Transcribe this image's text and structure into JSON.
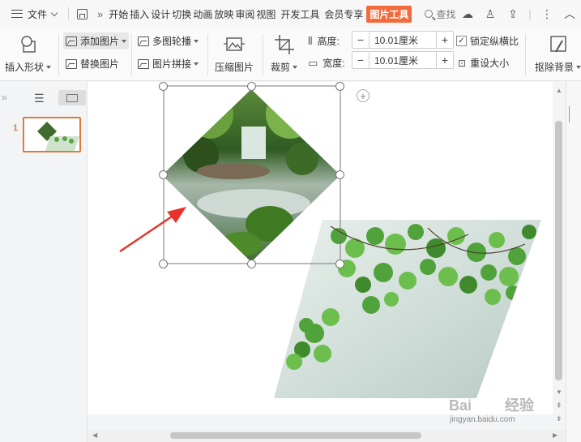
{
  "menu": {
    "file_label": "文件",
    "tabs": [
      "开始",
      "插入",
      "设计",
      "切换",
      "动画",
      "放映",
      "审阅",
      "视图",
      "开发工具",
      "会员专享"
    ],
    "active_tab": "图片工具",
    "search_label": "查找"
  },
  "ribbon": {
    "insert_shape": "插入形状",
    "add_image": "添加图片",
    "replace_image": "替换图片",
    "multi_carousel": "多图轮播",
    "image_collage": "图片拼接",
    "compress_image": "压缩图片",
    "crop": "裁剪",
    "height_label": "高度:",
    "height_value": "10.01厘米",
    "width_label": "宽度:",
    "width_value": "10.01厘米",
    "lock_ratio": "锁定纵横比",
    "lock_ratio_checked": true,
    "reset_size": "重设大小",
    "remove_bg": "抠除背景"
  },
  "slides": {
    "number": "1"
  },
  "watermark": {
    "brand": "Bai",
    "brand_suffix": "经验",
    "url": "jingyan.baidu.com"
  },
  "colors": {
    "accent": "#f36b3c",
    "selection": "#e07a3c",
    "arrow": "#e8332c"
  }
}
